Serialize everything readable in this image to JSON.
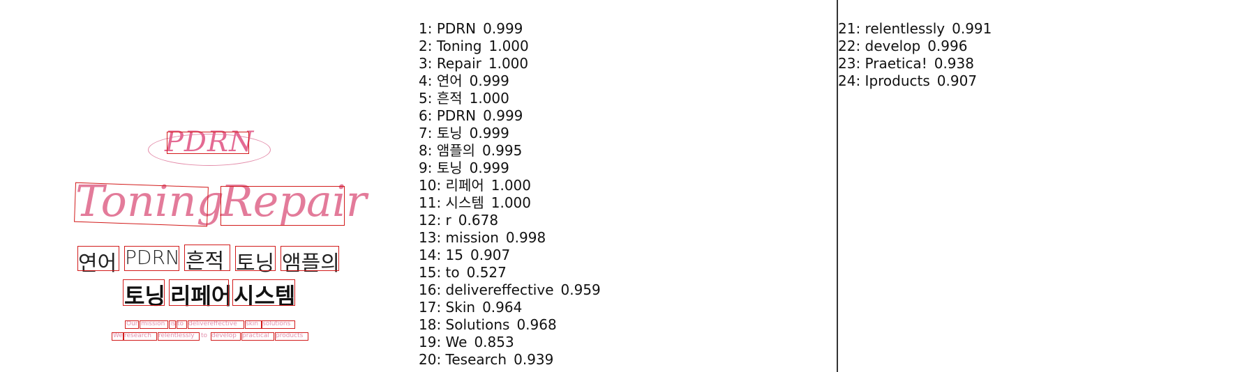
{
  "image_panel": {
    "logo_text": "PDRN",
    "headline_left": "Toning",
    "headline_right": "Repair",
    "korean_line1": [
      "연어",
      "PDRN",
      "흔적",
      "토닝",
      "앰플의"
    ],
    "korean_line2": [
      "토닝",
      "리페어",
      "시스템"
    ],
    "small_line1": [
      "Our",
      "mission",
      "is",
      "to",
      "delivereffective",
      "skin",
      "solutions"
    ],
    "small_line2": [
      "We",
      "research",
      "relentlessly",
      "to",
      "develop",
      "practical",
      "products"
    ],
    "colors": {
      "box": "#d21a1a",
      "pink": "#e37b9a",
      "ring": "#e38aa8"
    }
  },
  "results_column_1": [
    {
      "label": "1: PDRN",
      "score": "0.999"
    },
    {
      "label": "2: Toning",
      "score": "1.000"
    },
    {
      "label": "3: Repair",
      "score": "1.000"
    },
    {
      "label": "4: 연어",
      "score": "0.999"
    },
    {
      "label": "5: 흔적",
      "score": "1.000"
    },
    {
      "label": "6: PDRN",
      "score": "0.999"
    },
    {
      "label": "7: 토닝",
      "score": "0.999"
    },
    {
      "label": "8: 앰플의",
      "score": "0.995"
    },
    {
      "label": "9: 토닝",
      "score": "0.999"
    },
    {
      "label": "10: 리페어",
      "score": "1.000"
    },
    {
      "label": "11: 시스템",
      "score": "1.000"
    },
    {
      "label": "12: r",
      "score": "0.678"
    },
    {
      "label": "13: mission",
      "score": "0.998"
    },
    {
      "label": "14: 15",
      "score": "0.907"
    },
    {
      "label": "15: to",
      "score": "0.527"
    },
    {
      "label": "16: delivereffective",
      "score": "0.959"
    },
    {
      "label": "17: Skin",
      "score": "0.964"
    },
    {
      "label": "18: Solutions",
      "score": "0.968"
    },
    {
      "label": "19: We",
      "score": "0.853"
    },
    {
      "label": "20: Tesearch",
      "score": "0.939"
    }
  ],
  "results_column_2": [
    {
      "label": "21: relentlessly",
      "score": "0.991"
    },
    {
      "label": "22: develop",
      "score": "0.996"
    },
    {
      "label": "23: Praetica!",
      "score": "0.938"
    },
    {
      "label": "24: Iproducts",
      "score": "0.907"
    }
  ]
}
